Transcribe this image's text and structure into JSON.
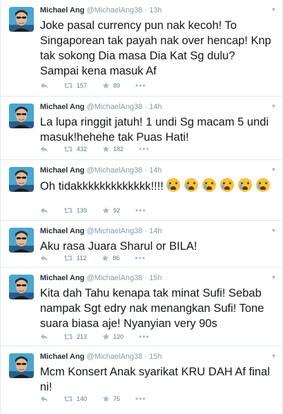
{
  "colors": {
    "text": "#14171a",
    "meta": "#8899a6",
    "divider": "#e1e8ed"
  },
  "tweets": [
    {
      "name": "Michael Ang",
      "handle": "@MichaelAng38",
      "time": "13h",
      "text": "Joke pasal currency pun nak kecoh! To Singaporean tak payah nak over hencap! Knp tak sokong Dia masa Dia Kat Sg dulu? Sampai kena masuk Af",
      "retweets": "157",
      "favorites": "89"
    },
    {
      "name": "Michael Ang",
      "handle": "@MichaelAng38",
      "time": "14h",
      "text": "La lupa ringgit jatuh! 1 undi Sg macam 5 undi masuk!hehehe tak Puas Hati!",
      "retweets": "432",
      "favorites": "182"
    },
    {
      "name": "Michael Ang",
      "handle": "@MichaelAng38",
      "time": "14h",
      "text": "Oh tidakkkkkkkkkkkkk!!!!",
      "emoji_count": 6,
      "retweets": "139",
      "favorites": "92"
    },
    {
      "name": "Michael Ang",
      "handle": "@MichaelAng38",
      "time": "14h",
      "text": "Aku rasa Juara Sharul or BILA!",
      "retweets": "112",
      "favorites": "86"
    },
    {
      "name": "Michael Ang",
      "handle": "@MichaelAng38",
      "time": "15h",
      "text": "Kita dah Tahu kenapa tak minat Sufi! Sebab nampak Sgt edry nak menangkan Sufi! Tone suara biasa aje! Nyanyian very 90s",
      "retweets": "213",
      "favorites": "120"
    },
    {
      "name": "Michael Ang",
      "handle": "@MichaelAng38",
      "time": "15h",
      "text": "Mcm Konsert Anak syarikat KRU DAH Af final ni!",
      "retweets": "140",
      "favorites": "75"
    }
  ]
}
